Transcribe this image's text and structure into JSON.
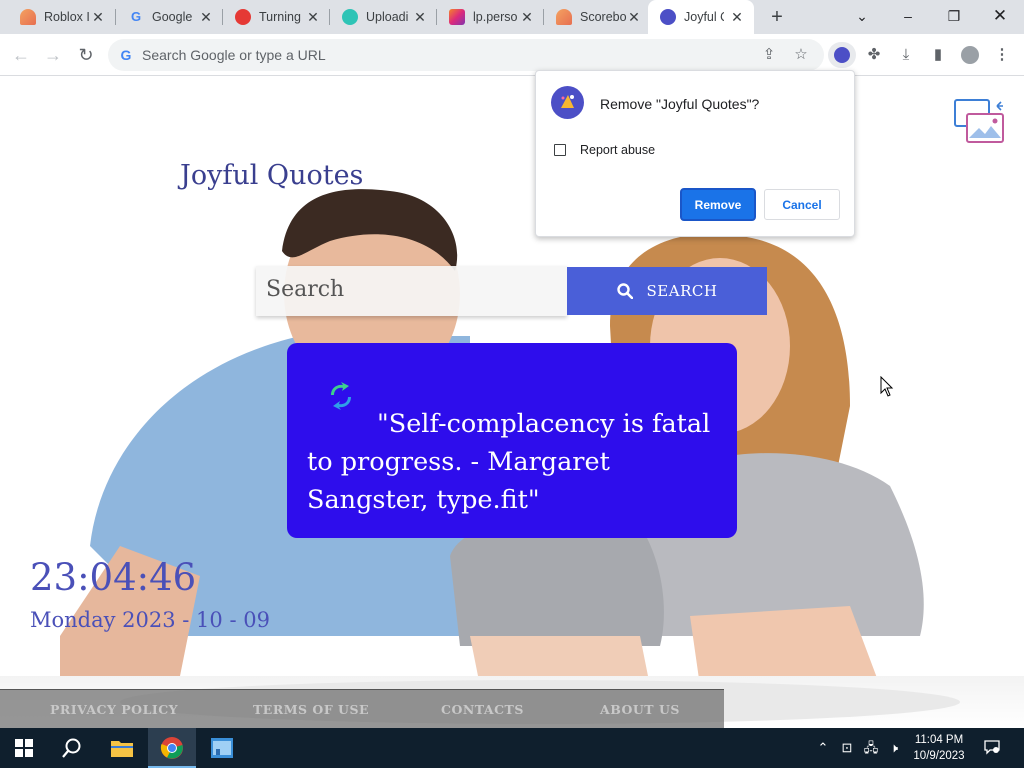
{
  "browser": {
    "tabs": [
      {
        "label": "Roblox I",
        "active": false
      },
      {
        "label": "Google",
        "active": false
      },
      {
        "label": "Turning",
        "active": false
      },
      {
        "label": "Uploadi",
        "active": false
      },
      {
        "label": "lp.perso",
        "active": false
      },
      {
        "label": "Scorebo",
        "active": false
      },
      {
        "label": "Joyful Q",
        "active": true
      }
    ],
    "omnibox_placeholder": "Search Google or type a URL"
  },
  "page": {
    "title": "Joyful Quotes",
    "search_placeholder": "Search",
    "search_button": "SEARCH",
    "quote": "\"Self-complacency is fatal to progress. - Margaret Sangster, type.fit\"",
    "clock": "23:04:46",
    "date": "Monday 2023 - 10 - 09",
    "footer": {
      "privacy": "PRIVACY POLICY",
      "terms": "TERMS OF USE",
      "contacts": "CONTACTS",
      "about": "ABOUT US"
    }
  },
  "dialog": {
    "title": "Remove \"Joyful Quotes\"?",
    "checkbox_label": "Report abuse",
    "remove": "Remove",
    "cancel": "Cancel"
  },
  "taskbar": {
    "time": "11:04 PM",
    "date": "10/9/2023"
  }
}
